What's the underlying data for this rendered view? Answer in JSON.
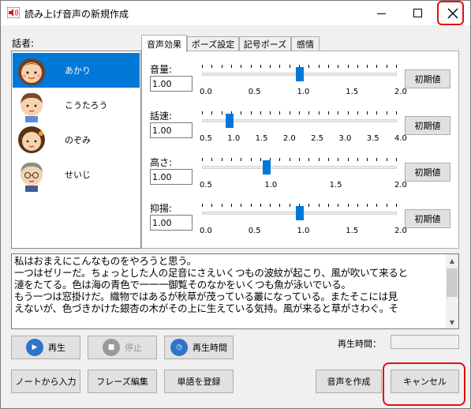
{
  "window": {
    "title": "読み上げ音声の新規作成",
    "controls": {
      "minimize": "minimize-icon",
      "maximize": "maximize-icon",
      "close": "close-icon"
    },
    "highlight_color": "#e01010"
  },
  "speakers": {
    "label": "話者:",
    "items": [
      {
        "name": "あかり",
        "selected": true
      },
      {
        "name": "こうたろう",
        "selected": false
      },
      {
        "name": "のぞみ",
        "selected": false
      },
      {
        "name": "せいじ",
        "selected": false
      }
    ],
    "selected_color": "#0078d7"
  },
  "tabs": [
    {
      "label": "音声効果",
      "active": true
    },
    {
      "label": "ポーズ設定",
      "active": false
    },
    {
      "label": "記号ポーズ",
      "active": false
    },
    {
      "label": "感情",
      "active": false
    }
  ],
  "params": [
    {
      "label": "音量:",
      "value": "1.00",
      "scale": [
        "0.0",
        "0.5",
        "1.0",
        "1.5",
        "2.0"
      ],
      "min": 0,
      "max": 2,
      "current": 1.0,
      "reset": "初期値"
    },
    {
      "label": "話速:",
      "value": "1.00",
      "scale": [
        "0.5",
        "1.0",
        "1.5",
        "2.0",
        "2.5",
        "3.0",
        "3.5",
        "4.0"
      ],
      "min": 0.5,
      "max": 4,
      "current": 1.0,
      "reset": "初期値"
    },
    {
      "label": "高さ:",
      "value": "1.00",
      "scale": [
        "0.5",
        "1.0",
        "1.5",
        "2.0"
      ],
      "min": 0.5,
      "max": 2,
      "current": 1.0,
      "reset": "初期値"
    },
    {
      "label": "抑揚:",
      "value": "1.00",
      "scale": [
        "0.0",
        "0.5",
        "1.0",
        "1.5",
        "2.0"
      ],
      "min": 0,
      "max": 2,
      "current": 1.0,
      "reset": "初期値"
    }
  ],
  "text": {
    "lines": [
      "私はおまえにこんなものをやろうと思う。",
      "一つはゼリーだ。ちょっとした人の足音にさえいくつもの波紋が起こり、風が吹いて来ると",
      "漣をたてる。色は海の青色で一一一御覧そのなかをいくつも魚が泳いでいる。",
      "もう一つは窓掛けだ。織物ではあるが秋草が茂っている叢になっている。またそこには見",
      "えないが、色づきかけた銀杏の木がその上に生えている気持。風が来ると草がさわぐ。そ"
    ]
  },
  "playback": {
    "play": "再生",
    "stop": "停止",
    "playtime_button": "再生時間",
    "playtime_label": "再生時間："
  },
  "actions": {
    "from_note": "ノートから入力",
    "phrase_edit": "フレーズ編集",
    "register_word": "単語を登録",
    "create_audio": "音声を作成",
    "cancel": "キャンセル"
  }
}
